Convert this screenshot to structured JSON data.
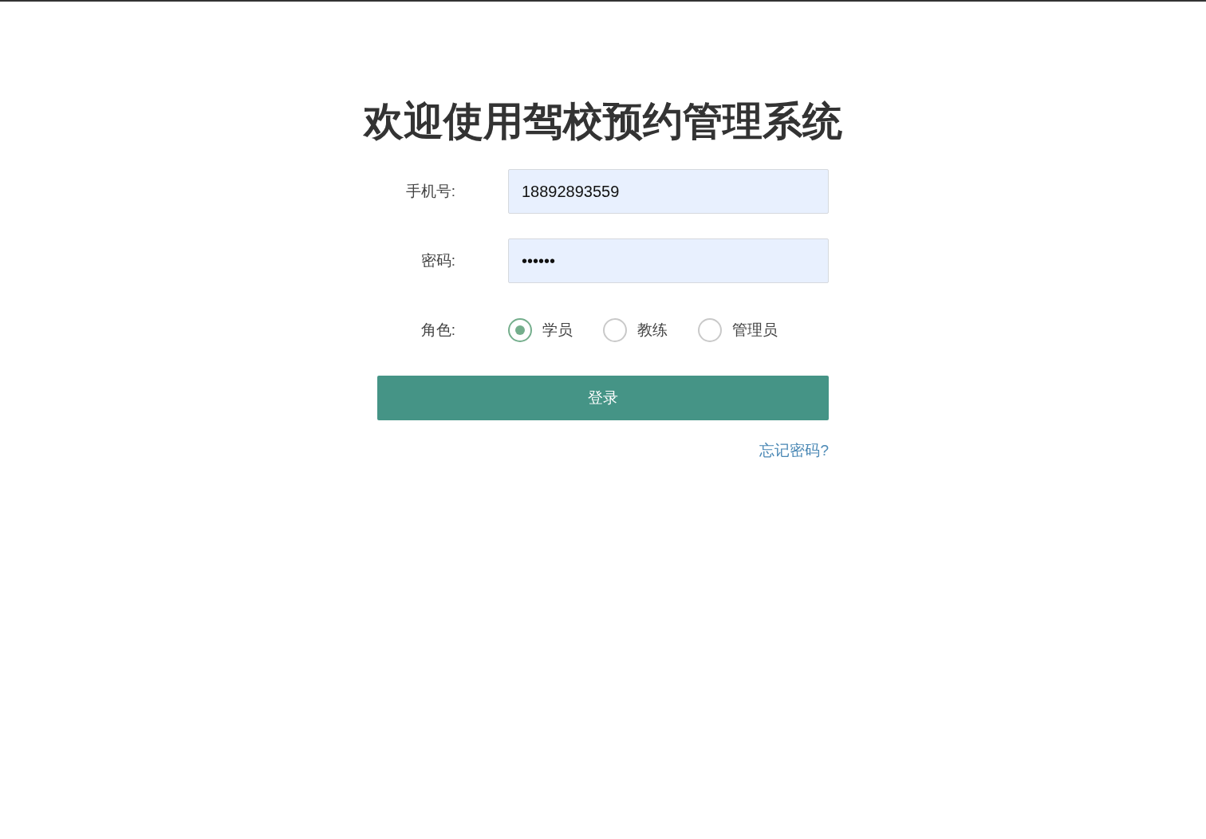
{
  "title": "欢迎使用驾校预约管理系统",
  "fields": [
    {
      "label": "手机号:",
      "value": "18892893559"
    },
    {
      "label": "密码:",
      "value": "••••••"
    }
  ],
  "role": {
    "label": "角色:",
    "options": [
      {
        "label": "学员",
        "selected": true
      },
      {
        "label": "教练",
        "selected": false
      },
      {
        "label": "管理员",
        "selected": false
      }
    ]
  },
  "login_button": "登录",
  "forgot_link": "忘记密码?"
}
